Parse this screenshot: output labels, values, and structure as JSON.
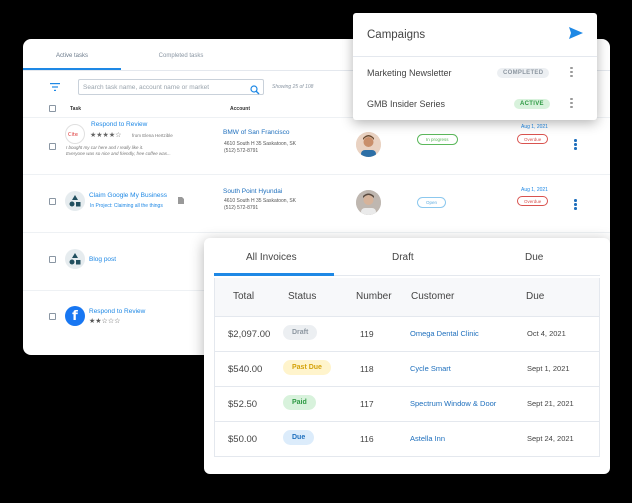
{
  "tasks": {
    "tabs": [
      "Active tasks",
      "Completed tasks"
    ],
    "search_placeholder": "Search task name, account name or market",
    "showing": "Showing 25 of 108",
    "headers": {
      "task": "Task",
      "account": "Account"
    },
    "rows": [
      {
        "title": "Respond to Review",
        "rating": "★★★★☆",
        "from": "from Elena Hertzible",
        "quote1": "I bought my car here and I really like it.",
        "quote2": "Everyone was so nice and friendly, free coffee was...",
        "account": "BMW of San Francisco",
        "addr1": "4610 South H 35 Saskatoon, SK",
        "addr2": "(512) 572-8791",
        "status": "In progress",
        "due": "Aug 1, 2021",
        "overdue": "Overdue"
      },
      {
        "title": "Claim Google My Business",
        "project": "In Project: Claiming all the things",
        "account": "South Point Hyundai",
        "addr1": "4610 South H 35 Saskatoon, SK",
        "addr2": "(512) 572-8791",
        "status": "Open",
        "due": "Aug 1, 2021",
        "overdue": "Overdue"
      },
      {
        "title": "Blog post"
      },
      {
        "title": "Respond to Review",
        "rating": "★★☆☆☆"
      }
    ]
  },
  "campaigns": {
    "title": "Campaigns",
    "items": [
      {
        "name": "Marketing Newsletter",
        "badge": "COMPLETED"
      },
      {
        "name": "GMB Insider Series",
        "badge": "ACTIVE"
      }
    ]
  },
  "invoices": {
    "tabs": [
      "All Invoices",
      "Draft",
      "Due"
    ],
    "headers": [
      "Total",
      "Status",
      "Number",
      "Customer",
      "Due"
    ],
    "rows": [
      {
        "total": "$2,097.00",
        "status": "Draft",
        "number": "119",
        "customer": "Omega Dental Clinic",
        "due": "Oct 4, 2021"
      },
      {
        "total": "$540.00",
        "status": "Past Due",
        "number": "118",
        "customer": "Cycle Smart",
        "due": "Sept 1, 2021"
      },
      {
        "total": "$52.50",
        "status": "Paid",
        "number": "117",
        "customer": "Spectrum Window & Door",
        "due": "Sept 21, 2021"
      },
      {
        "total": "$50.00",
        "status": "Due",
        "number": "116",
        "customer": "Astella Inn",
        "due": "Sept 24, 2021"
      }
    ]
  },
  "colors": {
    "accent": "#1e88e5",
    "draft_bg": "#eceff2",
    "pastdue_bg": "#fff4cc",
    "paid_bg": "#d8f2dc",
    "due_bg": "#dcecfb"
  }
}
